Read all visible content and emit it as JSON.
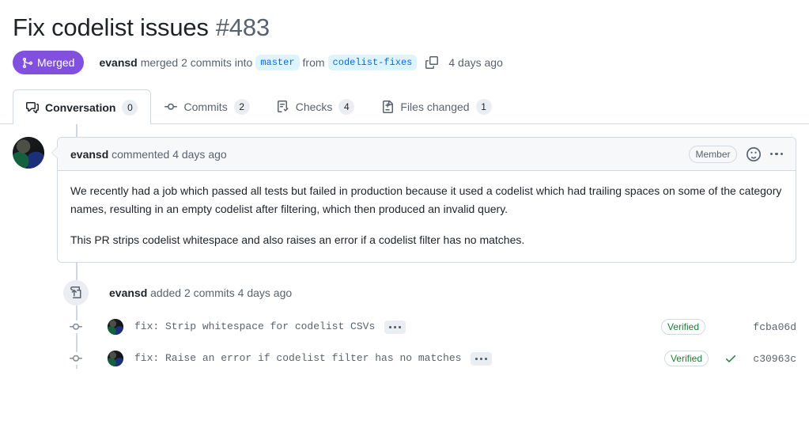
{
  "pull_request": {
    "title": "Fix codelist issues",
    "number": "#483",
    "state": {
      "label": "Merged",
      "icon": "git-merge-icon",
      "color": "#8250df"
    },
    "merge_meta": {
      "author": "evansd",
      "action_text": "merged 2 commits into",
      "base_branch": "master",
      "from_text": "from",
      "head_branch": "codelist-fixes",
      "copy_icon": "copy-icon",
      "timestamp": "4 days ago"
    }
  },
  "tabs": [
    {
      "label": "Conversation",
      "count": "0",
      "icon": "comment-discussion-icon",
      "selected": true
    },
    {
      "label": "Commits",
      "count": "2",
      "icon": "git-commit-icon",
      "selected": false
    },
    {
      "label": "Checks",
      "count": "4",
      "icon": "checklist-icon",
      "selected": false
    },
    {
      "label": "Files changed",
      "count": "1",
      "icon": "file-diff-icon",
      "selected": false
    }
  ],
  "comment": {
    "avatar_alt": "evansd avatar",
    "author": "evansd",
    "action_text": "commented",
    "timestamp": "4 days ago",
    "badge": "Member",
    "reaction_icon": "smiley-icon",
    "menu_icon": "kebab-horizontal-icon",
    "paragraphs": [
      "We recently had a job which passed all tests but failed in production because it used a codelist which had trailing spaces on some of the category names, resulting in an empty codelist after filtering, which then produced an invalid query.",
      "This PR strips codelist whitespace and also raises an error if a codelist filter has no matches."
    ]
  },
  "commits_event": {
    "icon": "repo-push-icon",
    "author": "evansd",
    "action_text": "added 2 commits",
    "timestamp": "4 days ago"
  },
  "commits": [
    {
      "node_icon": "git-commit-icon",
      "avatar_alt": "evansd avatar",
      "message": "fix: Strip whitespace for codelist CSVs",
      "menu_icon": "kebab-horizontal-icon",
      "verified": "Verified",
      "has_check": false,
      "sha": "fcba06d"
    },
    {
      "node_icon": "git-commit-icon",
      "avatar_alt": "evansd avatar",
      "message": "fix: Raise an error if codelist filter has no matches",
      "menu_icon": "kebab-horizontal-icon",
      "verified": "Verified",
      "has_check": true,
      "check_icon": "check-icon",
      "sha": "c30963c"
    }
  ],
  "colors": {
    "merged_purple": "#8250df",
    "link_blue": "#0969da",
    "branch_bg": "#ddf4ff",
    "verified_green": "#1a7f37",
    "border": "#d1d9e0",
    "muted_text": "#59636e",
    "header_bg": "#f6f8fa"
  }
}
